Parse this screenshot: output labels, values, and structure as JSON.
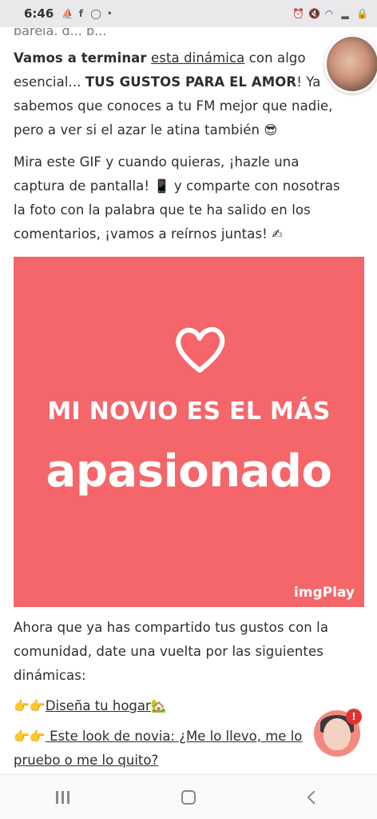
{
  "status_bar": {
    "time": "6:46",
    "left_icons": [
      "boat-icon",
      "facebook-icon",
      "whatsapp-icon",
      "dot-icon"
    ],
    "right_icons": [
      "alarm-icon",
      "mute-icon",
      "wifi-icon",
      "signal-icon",
      "lock-icon"
    ]
  },
  "article": {
    "cut_line": "pareja, g... p...",
    "p1": {
      "intro": "Vamos a terminar",
      "link": "esta dinámica",
      "mid": "con algo esencial...",
      "emph": "TUS GUSTOS PARA EL AMOR",
      "rest": "! Ya sabemos que conoces a tu FM mejor que nadie, pero a ver si el azar le atina también",
      "emoji": "😎"
    },
    "p2": {
      "text_a": "Mira este GIF y cuando quieras, ¡hazle una captura de pantalla!",
      "emoji_phone": "📱",
      "text_b": "y comparte con nosotras la foto con la palabra que te ha salido en los comentarios, ¡vamos a reírnos juntas!",
      "emoji_write": "✍"
    },
    "p3": "Ahora que ya has compartido tus gustos con la comunidad, date una vuelta por las siguientes dinámicas:",
    "links": [
      {
        "prefix": "👉👉",
        "label": "Diseña tu hogar",
        "suffix": "🏡"
      },
      {
        "prefix": "👉👉",
        "label": " Este look de novia: ¿Me lo llevo, me lo pruebo o me lo quito?",
        "suffix": ""
      }
    ]
  },
  "gif": {
    "line1": "MI NOVIO ES EL MÁS",
    "line2": "apasionado",
    "logo": "imgPlay",
    "color": "#f4666a"
  },
  "help": {
    "badge": "!"
  }
}
